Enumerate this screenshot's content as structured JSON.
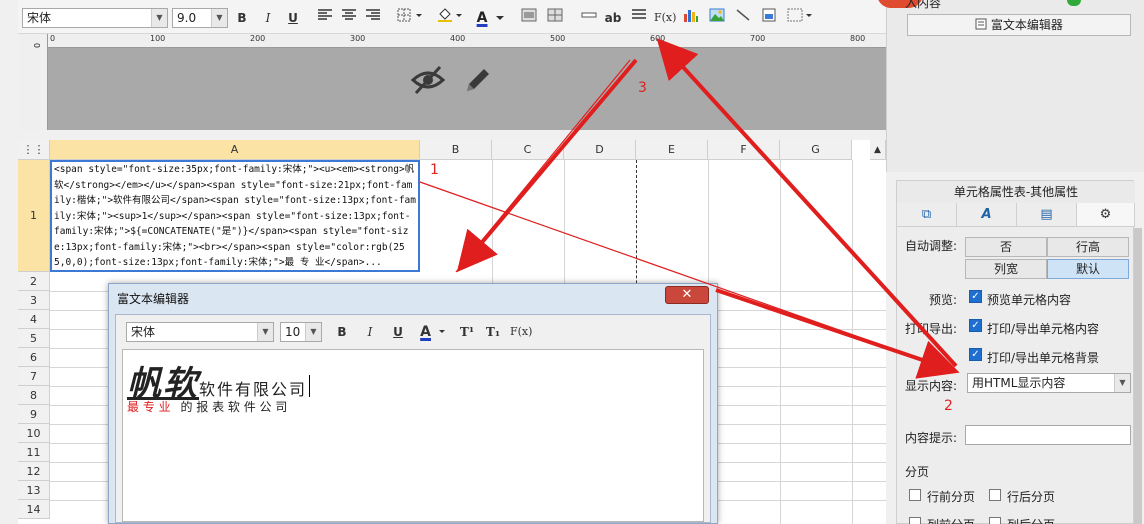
{
  "toolbar": {
    "font_name": "宋体",
    "font_size": "9.0",
    "bold": "B",
    "italic": "I",
    "underline": "U",
    "font_color_glyph": "A",
    "text_wrap": "ab",
    "fx": "F(x)"
  },
  "ruler": {
    "ticks": [
      "0",
      "100",
      "200",
      "300",
      "400",
      "500",
      "600",
      "700",
      "800"
    ]
  },
  "sheet": {
    "columns": [
      "A",
      "B",
      "C",
      "D",
      "E",
      "F",
      "G"
    ],
    "rows": [
      "1",
      "2",
      "3",
      "4",
      "5",
      "6",
      "7",
      "8",
      "9",
      "10",
      "11",
      "12",
      "13",
      "14"
    ],
    "cell_a1": "<span style=\"font-size:35px;font-family:宋体;\"><u><em><strong>帆软</strong></em></u></span><span style=\"font-size:21px;font-family:楷体;\">软件有限公司</span><span style=\"font-size:13px;font-family:宋体;\"><sup>1</sup></span><span style=\"font-size:13px;font-family:宋体;\">${=CONCATENATE(\"是\")}</span><span style=\"font-size:13px;font-family:宋体;\"><br></span><span style=\"color:rgb(255,0,0);font-size:13px;font-family:宋体;\">最 专 业</span>..."
  },
  "dialog": {
    "title": "富文本编辑器",
    "close": "✕",
    "font_name": "宋体",
    "font_size": "10",
    "bold": "B",
    "italic": "I",
    "underline": "U",
    "font_color_glyph": "A",
    "superscript": "T¹",
    "subscript": "T₁",
    "fx": "F(x)",
    "content_big": "帆软",
    "content_company": "软件有限公司",
    "content_red": "最 专 业",
    "content_rest": "的 报 表 软 件 公 司"
  },
  "right_panel_top": {
    "partial_label": "入内容",
    "rich_text_button": "富文本编辑器"
  },
  "right_panel": {
    "title": "单元格属性表-其他属性",
    "auto_adjust_label": "自动调整:",
    "auto_adjust_options": [
      "否",
      "行高",
      "列宽",
      "默认"
    ],
    "preview_label": "预览:",
    "preview_option": "预览单元格内容",
    "print_label": "打印导出:",
    "print_option_1": "打印/导出单元格内容",
    "print_option_2": "打印/导出单元格背景",
    "display_label": "显示内容:",
    "display_value": "用HTML显示内容",
    "tooltip_label": "内容提示:",
    "tooltip_value": "",
    "paging_label": "分页",
    "paging_options": [
      "行前分页",
      "行后分页",
      "列前分页",
      "列后分页"
    ]
  },
  "annotations": [
    "1",
    "2",
    "3"
  ],
  "colors": {
    "accent": "#3b79d4",
    "annotation": "#e01e1e",
    "check": "#1f6fd1"
  }
}
